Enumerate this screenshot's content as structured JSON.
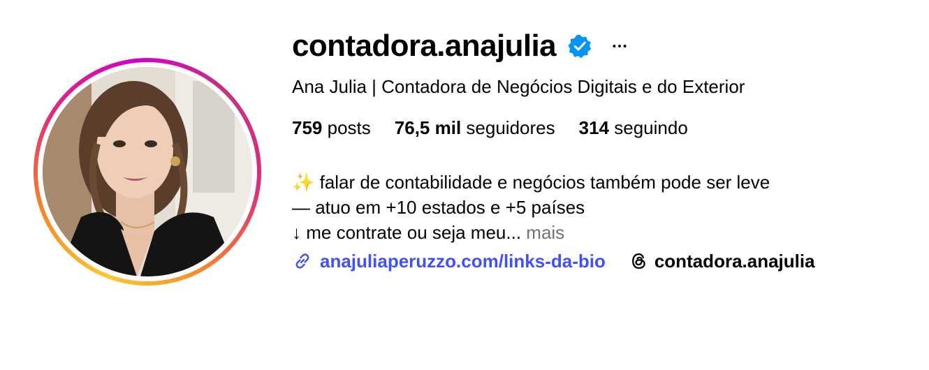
{
  "profile": {
    "username": "contadora.anajulia",
    "verified_icon": "verified-badge-icon",
    "more_icon": "more-options-icon",
    "full_name": "Ana Julia | Contadora de Negócios Digitais e do Exterior"
  },
  "stats": {
    "posts_count": "759",
    "posts_label": "posts",
    "followers_count": "76,5 mil",
    "followers_label": "seguidores",
    "following_count": "314",
    "following_label": "seguindo"
  },
  "bio": {
    "line1": "✨ falar de contabilidade e negócios também pode ser leve",
    "line2": "— atuo em +10 estados e +5 países",
    "line3": "↓ me contrate ou seja meu...",
    "more_label": "mais"
  },
  "links": {
    "website": "anajuliaperuzzo.com/links-da-bio",
    "website_icon": "link-icon",
    "threads_handle": "contadora.anajulia",
    "threads_icon": "threads-icon"
  },
  "colors": {
    "link_blue": "#4150f7",
    "verified_blue": "#0095f6",
    "muted_gray": "#737373"
  }
}
